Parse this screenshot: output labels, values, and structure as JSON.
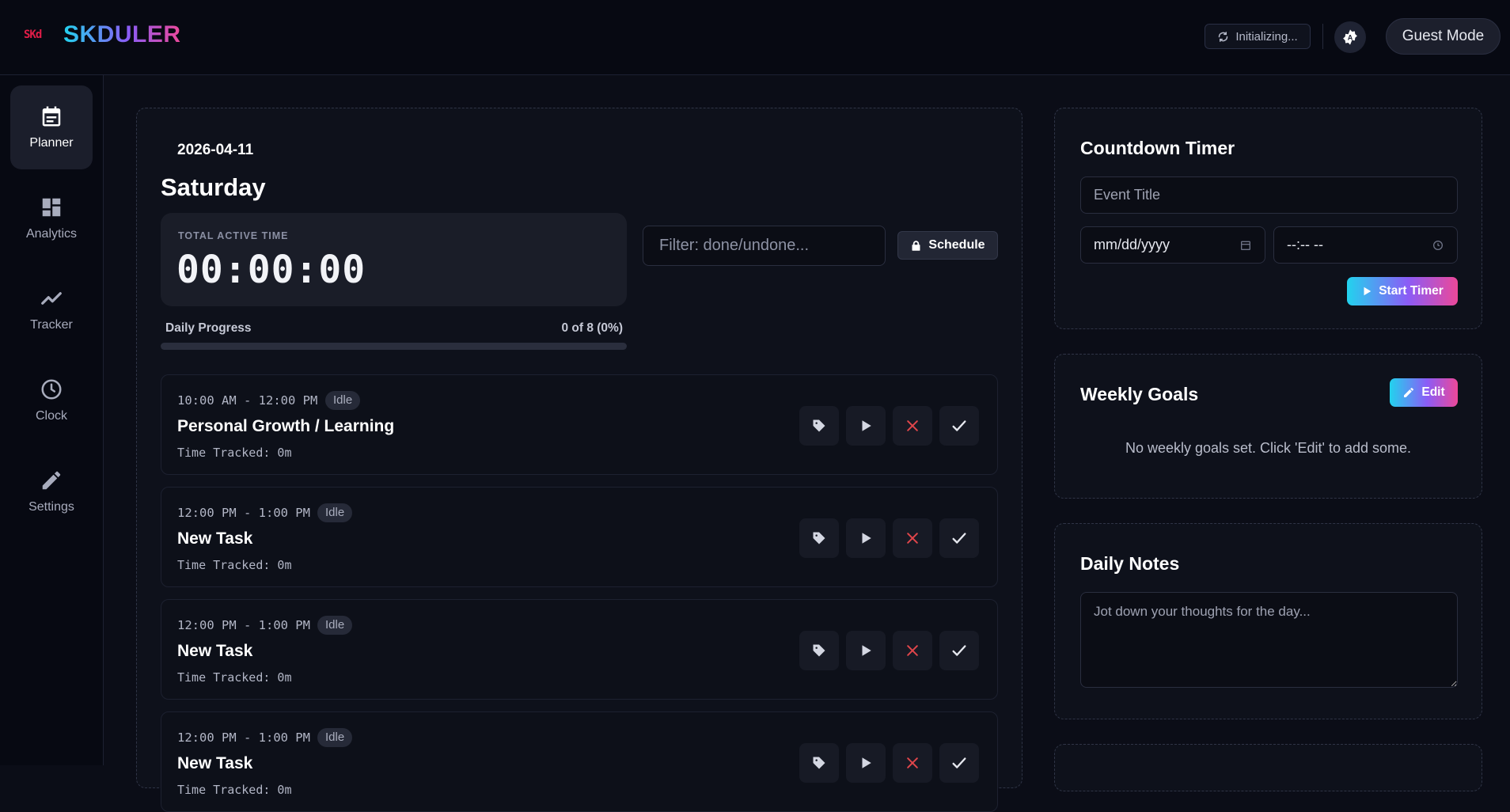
{
  "header": {
    "logo_mark": "SKd",
    "logo_text": "SKDULER",
    "status": "Initializing...",
    "guest_label": "Guest Mode"
  },
  "sidebar": {
    "items": [
      {
        "label": "Planner",
        "icon": "calendar-icon",
        "active": true
      },
      {
        "label": "Analytics",
        "icon": "dashboard-icon",
        "active": false
      },
      {
        "label": "Tracker",
        "icon": "trend-line-icon",
        "active": false
      },
      {
        "label": "Clock",
        "icon": "clock-icon",
        "active": false
      },
      {
        "label": "Settings",
        "icon": "pencil-icon",
        "active": false
      }
    ]
  },
  "planner": {
    "date": "2026-04-11",
    "day": "Saturday",
    "active_label": "TOTAL ACTIVE TIME",
    "active_time": "00:00:00",
    "filter_placeholder": "Filter: done/undone...",
    "schedule_label": "Schedule",
    "progress_label": "Daily Progress",
    "progress_count": "0 of 8 (0%)",
    "progress_fraction": 0,
    "tasks": [
      {
        "time": "10:00 AM - 12:00 PM",
        "status": "Idle",
        "title": "Personal Growth / Learning",
        "tracked": "Time Tracked: 0m"
      },
      {
        "time": "12:00 PM - 1:00 PM",
        "status": "Idle",
        "title": "New Task",
        "tracked": "Time Tracked: 0m"
      },
      {
        "time": "12:00 PM - 1:00 PM",
        "status": "Idle",
        "title": "New Task",
        "tracked": "Time Tracked: 0m"
      },
      {
        "time": "12:00 PM - 1:00 PM",
        "status": "Idle",
        "title": "New Task",
        "tracked": "Time Tracked: 0m"
      }
    ]
  },
  "countdown": {
    "title": "Countdown Timer",
    "event_placeholder": "Event Title",
    "date_placeholder": "mm/dd/yyyy",
    "time_placeholder": "--:-- --",
    "start_label": "Start Timer"
  },
  "weekly_goals": {
    "title": "Weekly Goals",
    "edit_label": "Edit",
    "empty_text": "No weekly goals set. Click 'Edit' to add some."
  },
  "daily_notes": {
    "title": "Daily Notes",
    "placeholder": "Jot down your thoughts for the day..."
  },
  "colors": {
    "accent_start": "#22d3ee",
    "accent_mid": "#8b5cf6",
    "accent_end": "#ec4899",
    "danger": "#e0464b",
    "background": "#0b0d17"
  }
}
